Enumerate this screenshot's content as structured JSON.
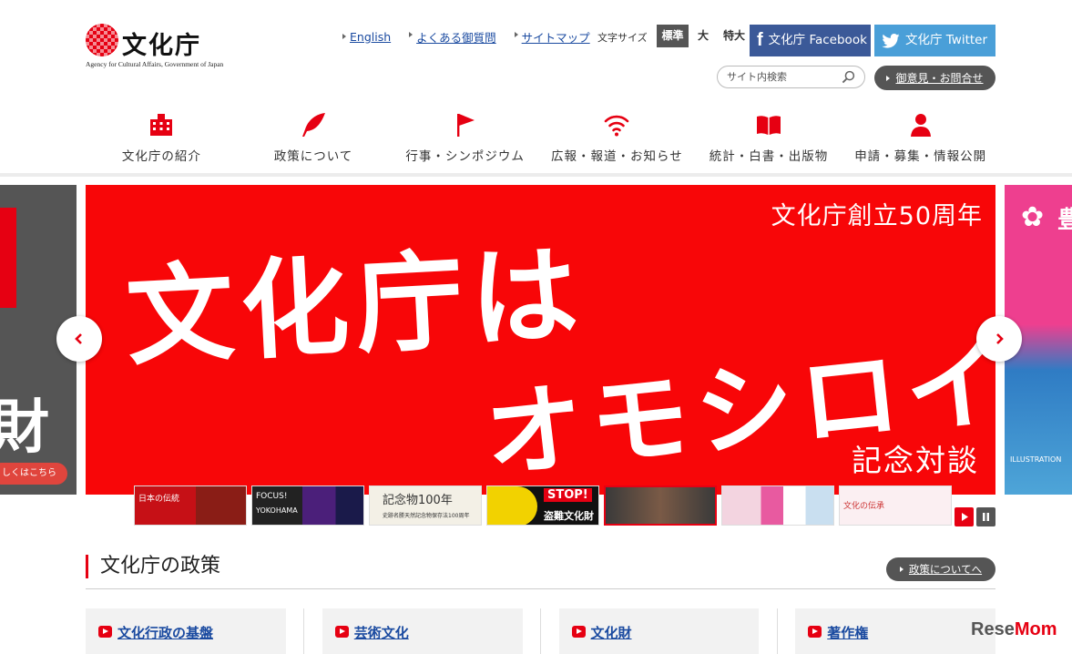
{
  "logo": {
    "name": "文化庁",
    "english": "Agency for Cultural Affairs, Government of Japan"
  },
  "utility": {
    "links": [
      "English",
      "よくある御質問",
      "サイトマップ"
    ],
    "font_size_label": "文字サイズ",
    "font_sizes": [
      "標準",
      "大",
      "特大"
    ],
    "facebook_label": "文化庁 Facebook",
    "twitter_label": "文化庁 Twitter",
    "search_placeholder": "サイト内検索",
    "contact_label": "御意見・お問合せ"
  },
  "gnav": [
    {
      "label": "文化庁の紹介",
      "icon": "building-icon"
    },
    {
      "label": "政策について",
      "icon": "feather-icon"
    },
    {
      "label": "行事・シンポジウム",
      "icon": "flag-icon"
    },
    {
      "label": "広報・報道・お知らせ",
      "icon": "wifi-icon"
    },
    {
      "label": "統計・白書・出版物",
      "icon": "book-icon"
    },
    {
      "label": "申請・募集・情報公開",
      "icon": "person-icon"
    }
  ],
  "slider": {
    "caption": "文化庁創立50周年",
    "headline_1": "文化庁は",
    "headline_2": "オモシロイ。",
    "subcaption": "記念対談",
    "left_peek_glyph": "財",
    "left_peek_cta": "しくはこちら",
    "right_peek_kanji": "豊",
    "right_peek_text": "ILLUSTRATION",
    "thumbnails": [
      {
        "title": "日本の伝統",
        "sub": ""
      },
      {
        "title": "FOCUS!",
        "sub": "YOKOHAMA"
      },
      {
        "title": "記念物100年",
        "sub": "史跡名勝天然記念物保存法100周年"
      },
      {
        "title": "STOP!",
        "sub": "盗難文化財"
      },
      {
        "title": "",
        "sub": ""
      },
      {
        "title": "",
        "sub": ""
      },
      {
        "title": "文化の伝承",
        "sub": ""
      }
    ]
  },
  "policy": {
    "title": "文化庁の政策",
    "more_label": "政策についてへ",
    "cards": [
      "文化行政の基盤",
      "芸術文化",
      "文化財",
      "著作権"
    ]
  },
  "watermark": {
    "text_a": "Rese",
    "text_b": "Mom"
  },
  "colors": {
    "accent": "#e60012",
    "link": "#1a4aa0",
    "facebook": "#3b5998",
    "twitter": "#4a9fd8"
  }
}
